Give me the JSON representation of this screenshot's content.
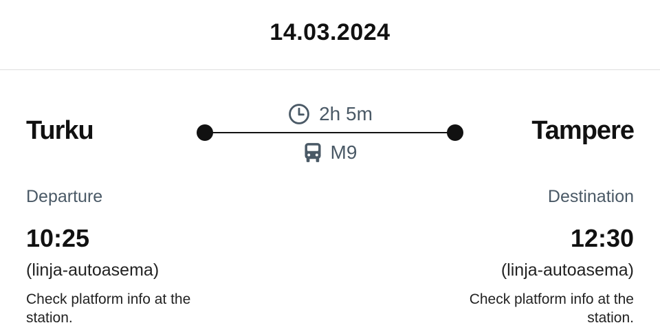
{
  "header": {
    "date": "14.03.2024"
  },
  "journey": {
    "origin": {
      "city": "Turku",
      "label": "Departure",
      "time": "10:25",
      "stop": "(linja-autoasema)",
      "note": "Check platform info at the station."
    },
    "destination": {
      "city": "Tampere",
      "label": "Destination",
      "time": "12:30",
      "stop": "(linja-autoasema)",
      "note": "Check platform info at the station."
    },
    "duration": "2h 5m",
    "line": "M9",
    "icons": {
      "duration": "clock-icon",
      "line": "bus-icon"
    }
  },
  "colors": {
    "text": "#111111",
    "muted": "#4a5966",
    "divider": "#dddddd",
    "background": "#ffffff"
  }
}
